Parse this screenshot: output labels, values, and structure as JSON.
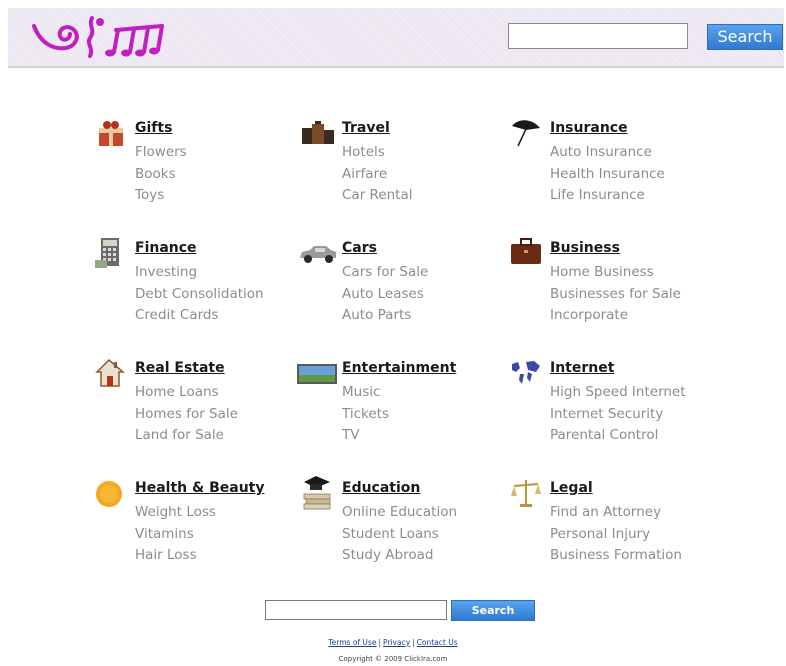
{
  "header": {
    "search_placeholder": "",
    "search_button": "Search"
  },
  "categories": [
    {
      "title": "Gifts",
      "icon": "gift-icon",
      "links": [
        "Flowers",
        "Books",
        "Toys"
      ]
    },
    {
      "title": "Travel",
      "icon": "luggage-icon",
      "links": [
        "Hotels",
        "Airfare",
        "Car Rental"
      ]
    },
    {
      "title": "Insurance",
      "icon": "umbrella-icon",
      "links": [
        "Auto Insurance",
        "Health Insurance",
        "Life Insurance"
      ]
    },
    {
      "title": "Finance",
      "icon": "calculator-icon",
      "links": [
        "Investing",
        "Debt Consolidation",
        "Credit Cards"
      ]
    },
    {
      "title": "Cars",
      "icon": "car-icon",
      "links": [
        "Cars for Sale",
        "Auto Leases",
        "Auto Parts"
      ]
    },
    {
      "title": "Business",
      "icon": "briefcase-icon",
      "links": [
        "Home Business",
        "Businesses for Sale",
        "Incorporate"
      ]
    },
    {
      "title": "Real Estate",
      "icon": "house-icon",
      "links": [
        "Home Loans",
        "Homes for Sale",
        "Land for Sale"
      ]
    },
    {
      "title": "Entertainment",
      "icon": "tv-screen-icon",
      "links": [
        "Music",
        "Tickets",
        "TV"
      ]
    },
    {
      "title": "Internet",
      "icon": "world-map-icon",
      "links": [
        "High Speed Internet",
        "Internet Security",
        "Parental Control"
      ]
    },
    {
      "title": "Health & Beauty",
      "icon": "orange-circle-icon",
      "links": [
        "Weight Loss",
        "Vitamins",
        "Hair Loss"
      ]
    },
    {
      "title": "Education",
      "icon": "graduation-cap-icon",
      "links": [
        "Online Education",
        "Student Loans",
        "Study Abroad"
      ]
    },
    {
      "title": "Legal",
      "icon": "scales-icon",
      "links": [
        "Find an Attorney",
        "Personal Injury",
        "Business Formation"
      ]
    }
  ],
  "bottom_search": {
    "button": "Search"
  },
  "footer": {
    "links": [
      "Terms of Use",
      "Privacy",
      "Contact Us"
    ],
    "separator": "|",
    "copyright": "Copyright © 2009 ClickIra.com"
  },
  "colors": {
    "header_bg": "#ece7f1",
    "logo": "#c21fc2",
    "button": "#3a86dc",
    "link_gray": "#8c8c8c"
  }
}
